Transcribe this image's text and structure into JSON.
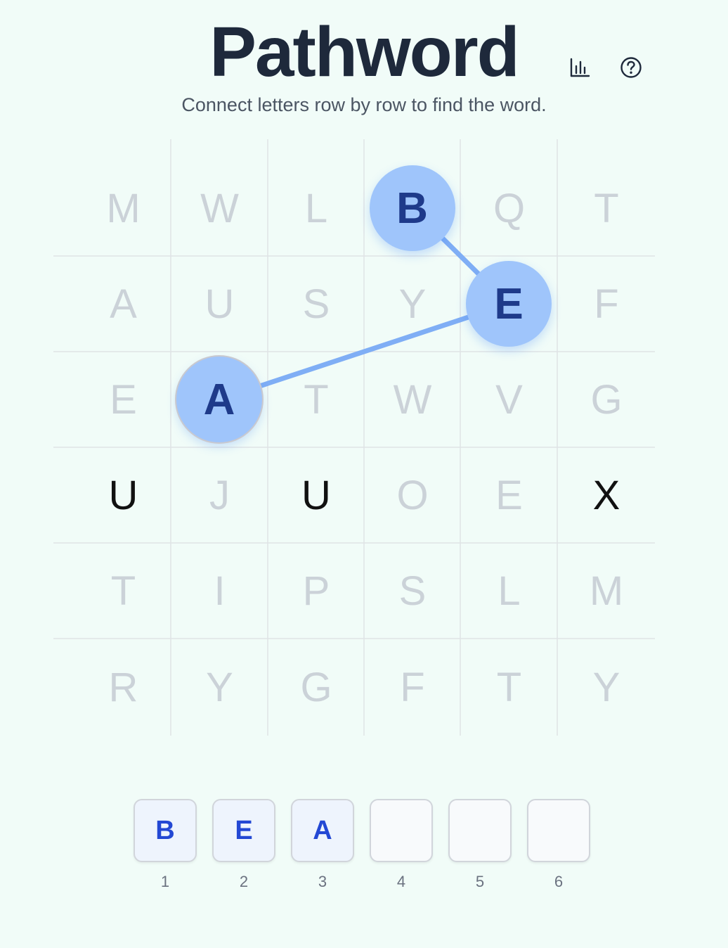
{
  "header": {
    "title": "Pathword",
    "subtitle": "Connect letters row by row to find the word.",
    "stats_icon": "bar-chart-icon",
    "help_icon": "question-circle-icon"
  },
  "grid": {
    "rows": [
      [
        "M",
        "W",
        "L",
        "B",
        "Q",
        "T"
      ],
      [
        "A",
        "U",
        "S",
        "Y",
        "E",
        "F"
      ],
      [
        "E",
        "A",
        "T",
        "W",
        "V",
        "G"
      ],
      [
        "U",
        "J",
        "U",
        "O",
        "E",
        "X"
      ],
      [
        "T",
        "I",
        "P",
        "S",
        "L",
        "M"
      ],
      [
        "R",
        "Y",
        "G",
        "F",
        "T",
        "Y"
      ]
    ],
    "path": [
      {
        "row": 1,
        "col": 4,
        "letter": "B"
      },
      {
        "row": 2,
        "col": 5,
        "letter": "E"
      },
      {
        "row": 3,
        "col": 2,
        "letter": "A"
      }
    ],
    "active_row": 4,
    "active_cells": [
      1,
      3,
      6
    ]
  },
  "answer": {
    "slots": [
      "B",
      "E",
      "A",
      "",
      "",
      ""
    ],
    "numbers": [
      "1",
      "2",
      "3",
      "4",
      "5",
      "6"
    ]
  },
  "colors": {
    "background": "#f1fcf8",
    "bubble": "#9fc5fb",
    "bubble_text": "#1e3a8a",
    "path_line": "#7faef5",
    "slot_text": "#2348d4",
    "inactive_letter": "#cbd2d8",
    "active_letter": "#111111"
  }
}
